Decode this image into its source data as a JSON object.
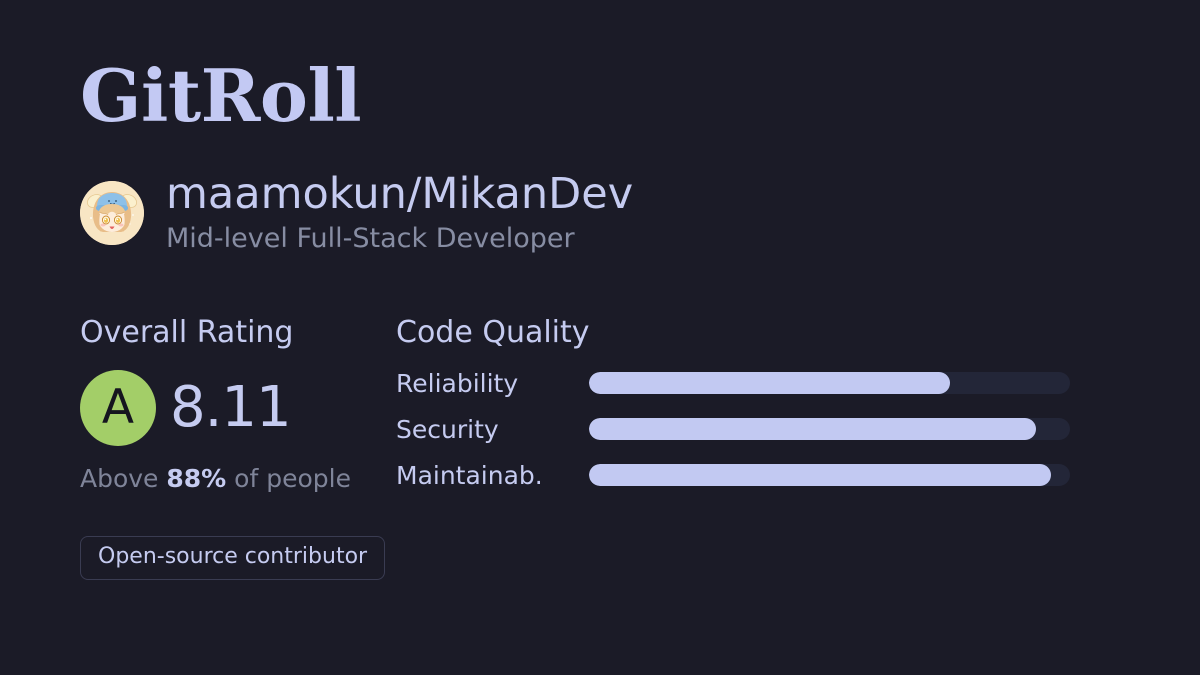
{
  "brand": {
    "name": "GitRoll"
  },
  "profile": {
    "username": "maamokun/MikanDev",
    "subtitle": "Mid-level Full-Stack Developer",
    "avatar_alt": "anime-avatar"
  },
  "overall_rating": {
    "heading": "Overall Rating",
    "grade": "A",
    "score": "8.11",
    "percentile_prefix": "Above ",
    "percentile_value": "88%",
    "percentile_suffix": " of people"
  },
  "code_quality": {
    "heading": "Code Quality",
    "metrics": [
      {
        "label": "Reliability",
        "percent": 75
      },
      {
        "label": "Security",
        "percent": 93
      },
      {
        "label": "Maintainab.",
        "percent": 96
      }
    ]
  },
  "tags": [
    {
      "label": "Open-source contributor"
    }
  ],
  "colors": {
    "background": "#1b1b27",
    "accent": "#c2c9f2",
    "muted_text": "#878da3",
    "grade_green": "#a3ce68",
    "track": "#232638",
    "tag_border": "#3a3c52"
  },
  "chart_data": {
    "type": "bar",
    "title": "Code Quality",
    "categories": [
      "Reliability",
      "Security",
      "Maintainab."
    ],
    "values": [
      75,
      93,
      96
    ],
    "xlabel": "",
    "ylabel": "",
    "xlim": [
      0,
      100
    ],
    "orientation": "horizontal",
    "grid": false,
    "legend": "none"
  }
}
